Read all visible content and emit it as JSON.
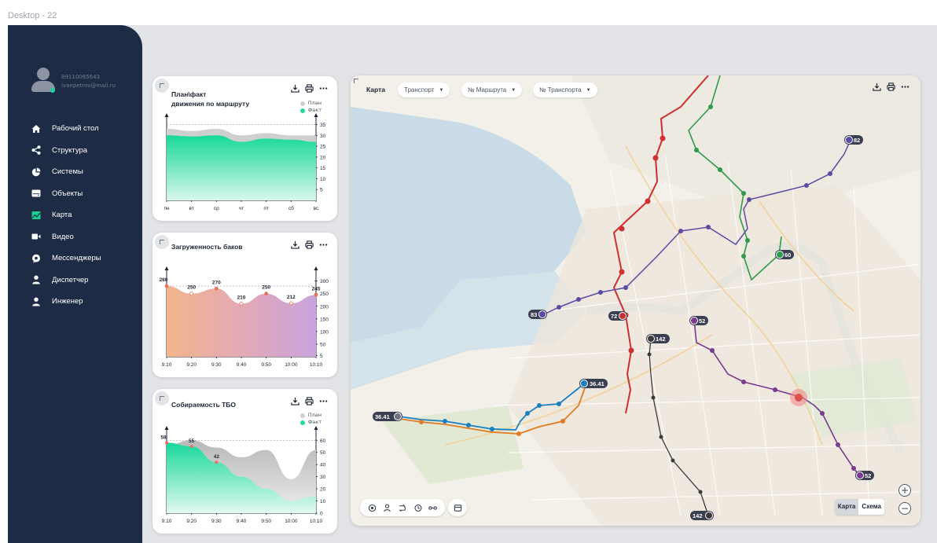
{
  "frame_label": "Desktop - 22",
  "user": {
    "phone": "89110065643",
    "email": "ivanpetrov@mail.ru"
  },
  "nav": [
    {
      "label": "Рабочий стол",
      "icon": "home-icon"
    },
    {
      "label": "Структура",
      "icon": "share-icon"
    },
    {
      "label": "Системы",
      "icon": "pie-chart-icon"
    },
    {
      "label": "Объекты",
      "icon": "drive-icon"
    },
    {
      "label": "Карта",
      "icon": "map-icon",
      "active": true
    },
    {
      "label": "Видео",
      "icon": "video-icon"
    },
    {
      "label": "Мессенджеры",
      "icon": "chat-icon"
    },
    {
      "label": "Диспетчер",
      "icon": "user-icon"
    },
    {
      "label": "Инженер",
      "icon": "user-icon"
    }
  ],
  "colors": {
    "sidebar": "#1e2b45",
    "plan": "#cfcfcf",
    "fact": "#1fdc9a",
    "accent_green": "#19d28f"
  },
  "card1": {
    "title_line1": "План\\факт",
    "title_line2": "движения по маршруту",
    "legend": [
      "План",
      "Факт"
    ],
    "chart_data": {
      "type": "area",
      "categories": [
        "пн",
        "вт",
        "ср",
        "чт",
        "пт",
        "сб",
        "вс"
      ],
      "series": [
        {
          "name": "План",
          "values": [
            33,
            32,
            33,
            30,
            31,
            30,
            30
          ]
        },
        {
          "name": "Факт",
          "values": [
            30,
            29.5,
            30,
            27,
            28.5,
            28,
            27
          ]
        }
      ],
      "yticks": [
        5,
        10,
        15,
        20,
        25,
        30,
        35
      ],
      "ylim": [
        0,
        37
      ]
    }
  },
  "card2": {
    "title": "Загруженность баков",
    "chart_data": {
      "type": "area",
      "categories": [
        "9:10",
        "9:20",
        "9:30",
        "9:40",
        "9:50",
        "10:00",
        "10:10"
      ],
      "values": [
        280,
        250,
        270,
        210,
        250,
        212,
        245
      ],
      "yticks": [
        5,
        50,
        100,
        150,
        200,
        250,
        300
      ],
      "ylim": [
        0,
        330
      ]
    }
  },
  "card3": {
    "title": "Собираемость ТБО",
    "legend": [
      "План",
      "Факт"
    ],
    "chart_data": {
      "type": "area",
      "categories": [
        "9:10",
        "9:20",
        "9:30",
        "9:40",
        "9:50",
        "10:00",
        "10:10"
      ],
      "series": [
        {
          "name": "План",
          "values": [
            56,
            60,
            54,
            46,
            52,
            28,
            52
          ]
        },
        {
          "name": "Факт",
          "values": [
            58,
            55,
            42,
            30,
            20,
            10,
            14
          ]
        }
      ],
      "point_labels": [
        {
          "index": 0,
          "value": "58"
        },
        {
          "index": 1,
          "value": "55"
        },
        {
          "index": 2,
          "value": "42"
        }
      ],
      "yticks": [
        0,
        10,
        20,
        30,
        40,
        50,
        60
      ],
      "ylim": [
        0,
        66
      ]
    }
  },
  "map": {
    "title": "Карта",
    "filters": [
      "Транспорт",
      "№ Маршрута",
      "№ Транспорта"
    ],
    "routes": [
      "82",
      "60",
      "83",
      "72",
      "52",
      "142",
      "36.41",
      "36.41",
      "142",
      "52"
    ],
    "view": [
      "Карта",
      "Схема"
    ],
    "zoom_in": "+",
    "zoom_out": "−"
  }
}
